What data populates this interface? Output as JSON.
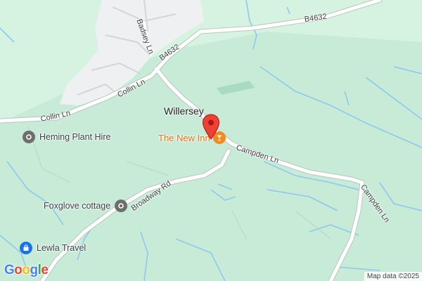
{
  "colors": {
    "fields": "#c8ebd8",
    "fields_light": "#d6f2e1",
    "town": "#eef0f2",
    "road": "#ffffff",
    "road_casing": "#b9c6bd",
    "water": "#8cc9f0",
    "poi_grey": "#6e6e6e",
    "poi_blue": "#1a73e8",
    "pin_red": "#ea4335",
    "restaurant_orange": "#f28b1f"
  },
  "places": {
    "village": "Willersey"
  },
  "roads": {
    "b4632_top": "B4632",
    "b4632_left": "B4632",
    "badsey_ln": "Badsey Ln",
    "collin_ln_upper": "Collin Ln",
    "collin_ln_lower": "Collin Ln",
    "campden_ln_1": "Campden Ln",
    "campden_ln_2": "Campden Ln",
    "broadway_rd": "Broadway Rd"
  },
  "pois": [
    {
      "label": "Heming Plant Hire",
      "icon": "pin-outline-icon"
    },
    {
      "label": "Foxglove cottage",
      "icon": "pin-outline-icon"
    },
    {
      "label": "Lewla Travel",
      "icon": "shopping-bag-icon"
    },
    {
      "label": "The New Inn",
      "icon": "cocktail-glass-icon"
    }
  ],
  "marker": {
    "icon": "red-map-pin-icon"
  },
  "logo": {
    "letters": [
      "G",
      "o",
      "o",
      "g",
      "l",
      "e"
    ],
    "colors": [
      "#4285f4",
      "#ea4335",
      "#fbbc05",
      "#4285f4",
      "#34a853",
      "#ea4335"
    ]
  },
  "attribution": "Map data ©2025"
}
